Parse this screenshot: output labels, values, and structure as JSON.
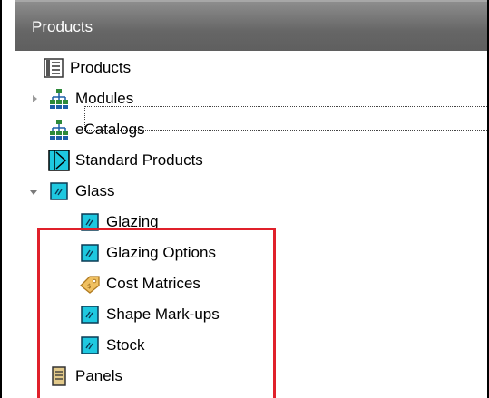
{
  "panel": {
    "title": "Products"
  },
  "tree": {
    "products": {
      "label": "Products",
      "icon": "book-icon"
    },
    "modules": {
      "label": "Modules",
      "icon": "hierarchy-icon",
      "expander": "collapsed"
    },
    "ecatalogs": {
      "label": "eCatalogs",
      "icon": "hierarchy-icon"
    },
    "standard_products": {
      "label": "Standard Products",
      "icon": "standard-product-icon"
    },
    "glass": {
      "label": "Glass",
      "icon": "glass-icon",
      "expander": "expanded",
      "children": {
        "glazing": {
          "label": "Glazing",
          "icon": "glass-icon"
        },
        "glazing_options": {
          "label": "Glazing Options",
          "icon": "glass-icon"
        },
        "cost_matrices": {
          "label": "Cost Matrices",
          "icon": "price-tag-icon"
        },
        "shape_markups": {
          "label": "Shape Mark-ups",
          "icon": "glass-icon"
        },
        "stock": {
          "label": "Stock",
          "icon": "glass-icon"
        }
      }
    },
    "panels": {
      "label": "Panels",
      "icon": "panel-icon"
    }
  },
  "colors": {
    "highlight_border": "#e0202a",
    "header_bg": "#6b6b6b",
    "glass_icon": "#1ec8e0"
  }
}
